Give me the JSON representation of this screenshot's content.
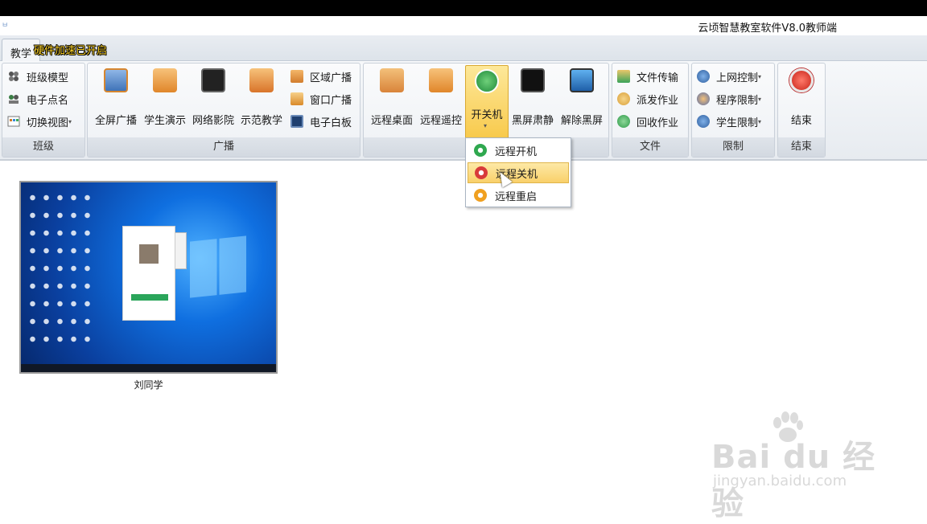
{
  "window": {
    "app_icon": "ㅂ",
    "title": "云顷智慧教室软件V8.0教师端"
  },
  "tabs": [
    {
      "label": "教学"
    }
  ],
  "hardware_note": "硬件加速已开启",
  "ribbon": {
    "class_group": {
      "label": "班级",
      "items": [
        {
          "label": "班级模型",
          "icon": "class-model-icon"
        },
        {
          "label": "电子点名",
          "icon": "roll-call-icon"
        },
        {
          "label": "切换视图",
          "icon": "switch-view-icon",
          "dropdown": true
        }
      ]
    },
    "broadcast_group": {
      "label": "广播",
      "big_items": [
        {
          "label": "全屏广播",
          "icon": "fullscreen-broadcast-icon"
        },
        {
          "label": "学生演示",
          "icon": "student-demo-icon"
        },
        {
          "label": "网络影院",
          "icon": "network-cinema-icon"
        },
        {
          "label": "示范教学",
          "icon": "demo-teaching-icon"
        }
      ],
      "small_items": [
        {
          "label": "区域广播",
          "icon": "area-broadcast-icon"
        },
        {
          "label": "窗口广播",
          "icon": "window-broadcast-icon"
        },
        {
          "label": "电子白板",
          "icon": "whiteboard-icon"
        }
      ]
    },
    "remote_group": {
      "label": "",
      "items": [
        {
          "label": "远程桌面",
          "icon": "remote-desktop-icon"
        },
        {
          "label": "远程遥控",
          "icon": "remote-control-icon"
        },
        {
          "label": "开关机",
          "icon": "power-icon",
          "active": true,
          "dropdown": true
        },
        {
          "label": "黑屏肃静",
          "icon": "black-screen-lock-icon"
        },
        {
          "label": "解除黑屏",
          "icon": "unlock-screen-icon"
        }
      ]
    },
    "file_group": {
      "label": "文件",
      "items": [
        {
          "label": "文件传输",
          "icon": "file-transfer-icon"
        },
        {
          "label": "派发作业",
          "icon": "assign-homework-icon"
        },
        {
          "label": "回收作业",
          "icon": "collect-homework-icon"
        }
      ]
    },
    "limit_group": {
      "label": "限制",
      "items": [
        {
          "label": "上网控制",
          "icon": "web-control-icon",
          "dropdown": true
        },
        {
          "label": "程序限制",
          "icon": "program-limit-icon",
          "dropdown": true
        },
        {
          "label": "学生限制",
          "icon": "student-limit-icon",
          "dropdown": true
        }
      ]
    },
    "end_group": {
      "label": "结束",
      "items": [
        {
          "label": "结束",
          "icon": "stop-icon"
        }
      ]
    }
  },
  "power_menu": {
    "items": [
      {
        "label": "远程开机",
        "icon": "remote-power-on-icon",
        "color": "#2fa84f"
      },
      {
        "label": "远程关机",
        "icon": "remote-shutdown-icon",
        "color": "#d83a3a",
        "hovered": true
      },
      {
        "label": "远程重启",
        "icon": "remote-restart-icon",
        "color": "#f0a020"
      }
    ]
  },
  "students": [
    {
      "name": "刘同学"
    }
  ],
  "watermark": {
    "main": "Bai du 经验",
    "sub": "jingyan.baidu.com"
  },
  "colors": {
    "ribbon_active": "#f8c94a",
    "menu_hover": "#f9d06a",
    "desktop_blue": "#0f6fe0"
  }
}
